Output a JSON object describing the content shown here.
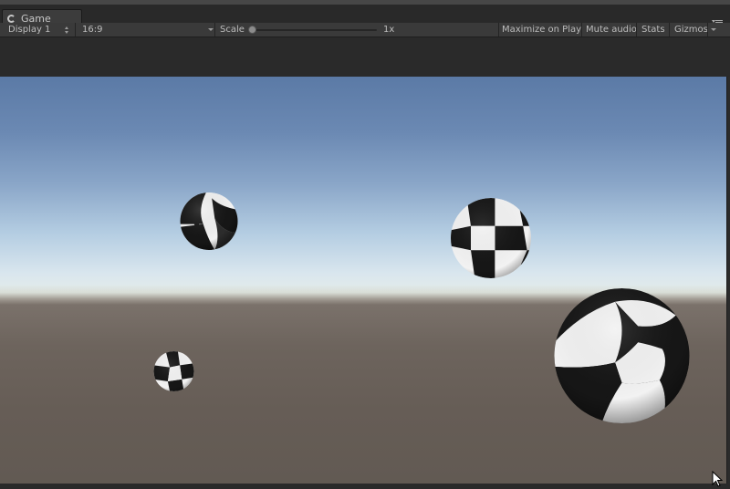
{
  "window": {
    "tab_title": "Game",
    "tab_icon": "unity-game-icon",
    "pane_menu_icon": "pane-menu-icon"
  },
  "toolbar": {
    "display": "Display 1",
    "aspect": "16:9",
    "scale_label": "Scale",
    "scale_value": "1x",
    "scale_level": 0.0,
    "maximize_on_play": "Maximize on Play",
    "mute_audio": "Mute audio",
    "stats": "Stats",
    "gizmos": "Gizmos"
  },
  "scene": {
    "objects": [
      "checkered-sphere",
      "checkered-sphere",
      "checkered-sphere",
      "checkered-sphere"
    ],
    "colors": {
      "sky_top": "#5b7aa6",
      "sky_horizon": "#e8eee9",
      "ground": "#6d645d",
      "checker_dark": "#161616",
      "checker_light": "#f2f2f2"
    }
  }
}
